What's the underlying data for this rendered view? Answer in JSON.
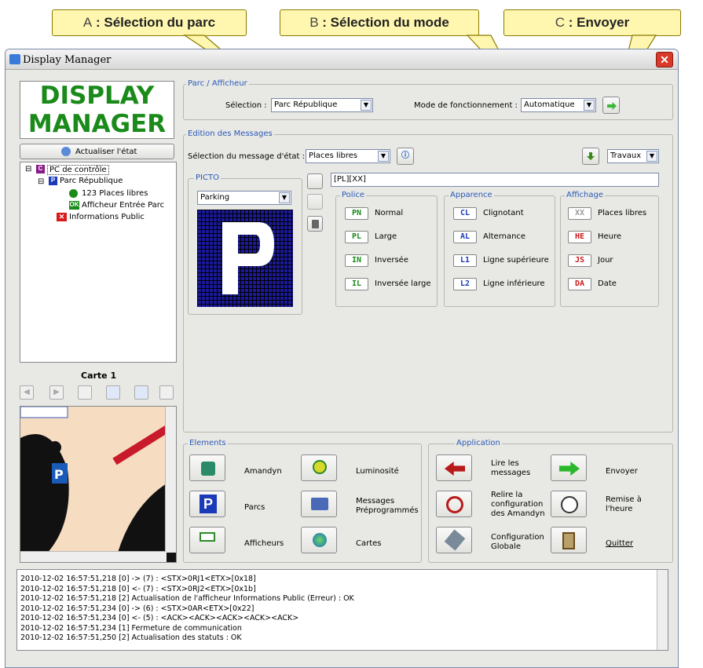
{
  "callouts": {
    "a_letter": "A",
    "a_text": ": Sélection du parc",
    "b_letter": "B",
    "b_text": ": Sélection du mode",
    "c_letter": "C",
    "c_text": ": Envoyer"
  },
  "window": {
    "title": "Display Manager"
  },
  "logo": {
    "line1": "DISPLAY",
    "line2": "MANAGER"
  },
  "refresh_label": "Actualiser l'état",
  "tree": {
    "root": "PC de contrôle",
    "park": "Parc République",
    "places": "123 Places libres",
    "display": "Afficheur Entrée Parc",
    "info": "Informations Public",
    "ok_badge": "OK"
  },
  "map": {
    "title": "Carte 1"
  },
  "parc_group": {
    "title": "Parc / Afficheur",
    "selection_label": "Sélection :",
    "selection_value": "Parc République",
    "mode_label": "Mode de fonctionnement :",
    "mode_value": "Automatique"
  },
  "edition": {
    "title": "Edition des Messages",
    "state_label": "Sélection du message d'état :",
    "state_value": "Places libres",
    "travaux_value": "Travaux",
    "picto_title": "PICTO",
    "picto_value": "Parking",
    "message_text": "[PL][XX]"
  },
  "police": {
    "title": "Police",
    "items": [
      {
        "code": "PN",
        "label": "Normal"
      },
      {
        "code": "PL",
        "label": "Large"
      },
      {
        "code": "IN",
        "label": "Inversée"
      },
      {
        "code": "IL",
        "label": "Inversée large"
      }
    ]
  },
  "apparence": {
    "title": "Apparence",
    "items": [
      {
        "code": "CL",
        "label": "Clignotant"
      },
      {
        "code": "AL",
        "label": "Alternance"
      },
      {
        "code": "L1",
        "label": "Ligne supérieure"
      },
      {
        "code": "L2",
        "label": "Ligne inférieure"
      }
    ]
  },
  "affichage": {
    "title": "Affichage",
    "items": [
      {
        "code": "XX",
        "label": "Places libres"
      },
      {
        "code": "HE",
        "label": "Heure"
      },
      {
        "code": "JS",
        "label": "Jour"
      },
      {
        "code": "DA",
        "label": "Date"
      }
    ]
  },
  "elements": {
    "title": "Elements",
    "amandyn": "Amandyn",
    "luminosite": "Luminosité",
    "parcs": "Parcs",
    "messages1": "Messages",
    "messages2": "Préprogrammés",
    "afficheurs": "Afficheurs",
    "cartes": "Cartes"
  },
  "application": {
    "title": "Application",
    "lire1": "Lire les",
    "lire2": "messages",
    "envoyer": "Envoyer",
    "relire1": "Relire la",
    "relire2": "configuration",
    "relire3": "des Amandyn",
    "remise1": "Remise à",
    "remise2": "l'heure",
    "config1": "Configuration",
    "config2": "Globale",
    "quitter": "Quitter"
  },
  "log": [
    "2010-12-02 16:57:51,218 [0] -> (7) : <STX>0RJ1<ETX>[0x18]",
    "2010-12-02 16:57:51,218 [0] <- (7) : <STX>0RJ2<ETX>[0x1b]",
    "2010-12-02 16:57:51,218 [2] Actualisation de l'afficheur Informations Public (Erreur) : OK",
    "2010-12-02 16:57:51,234 [0] -> (6) : <STX>0AR<ETX>[0x22]",
    "2010-12-02 16:57:51,234 [0] <- (5) : <ACK><ACK><ACK><ACK><ACK>",
    "2010-12-02 16:57:51,234 [1] Fermeture de communication",
    "2010-12-02 16:57:51,250 [2] Actualisation des statuts : OK"
  ]
}
